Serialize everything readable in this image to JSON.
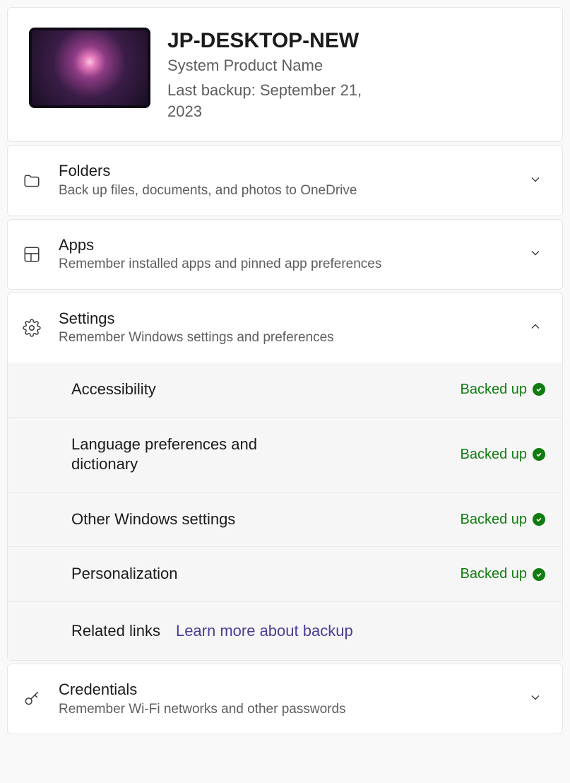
{
  "device": {
    "name": "JP-DESKTOP-NEW",
    "product": "System Product Name",
    "last_backup": "Last backup: September 21, 2023"
  },
  "sections": {
    "folders": {
      "title": "Folders",
      "desc": "Back up files, documents, and photos to OneDrive",
      "expanded": false
    },
    "apps": {
      "title": "Apps",
      "desc": "Remember installed apps and pinned app preferences",
      "expanded": false
    },
    "settings": {
      "title": "Settings",
      "desc": "Remember Windows settings and preferences",
      "expanded": true,
      "items": [
        {
          "label": "Accessibility",
          "status": "Backed up"
        },
        {
          "label": "Language preferences and dictionary",
          "status": "Backed up"
        },
        {
          "label": "Other Windows settings",
          "status": "Backed up"
        },
        {
          "label": "Personalization",
          "status": "Backed up"
        }
      ],
      "related_label": "Related links",
      "related_link": "Learn more about backup"
    },
    "credentials": {
      "title": "Credentials",
      "desc": "Remember Wi-Fi networks and other passwords",
      "expanded": false
    }
  },
  "colors": {
    "status_green": "#107c10",
    "link_purple": "#4b3d96"
  }
}
